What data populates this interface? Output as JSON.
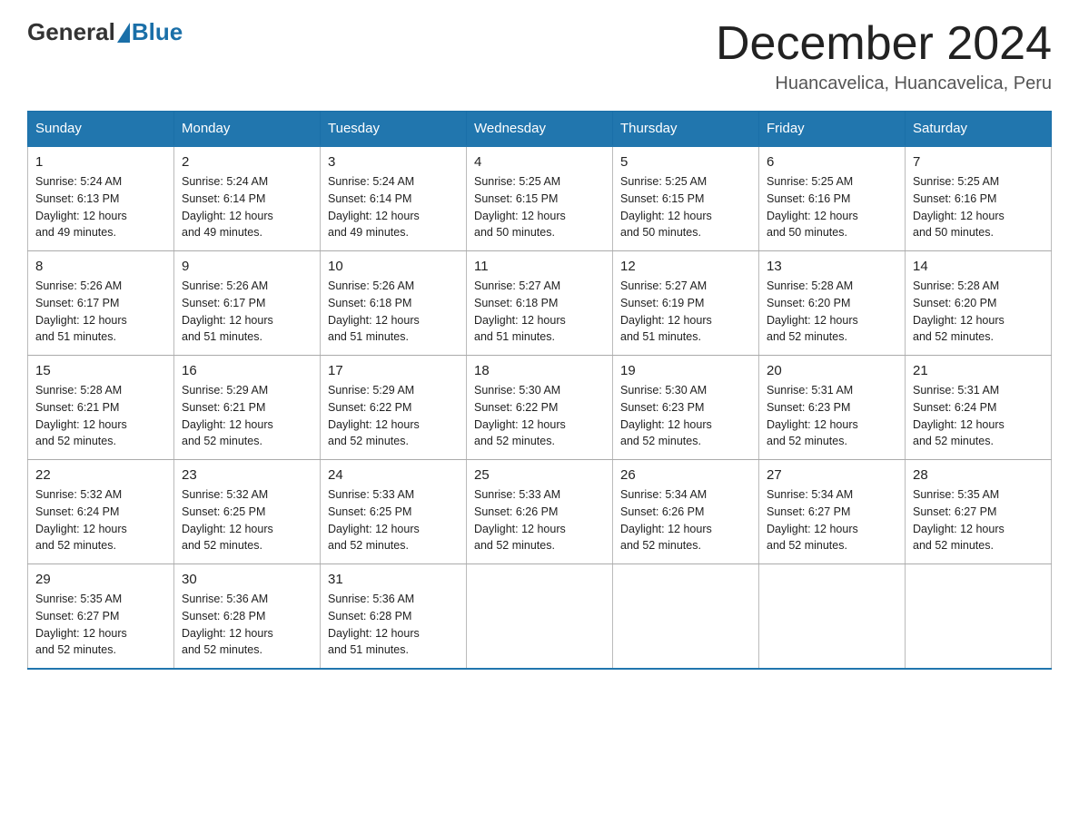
{
  "header": {
    "logo_general": "General",
    "logo_blue": "Blue",
    "month_title": "December 2024",
    "location": "Huancavelica, Huancavelica, Peru"
  },
  "days_of_week": [
    "Sunday",
    "Monday",
    "Tuesday",
    "Wednesday",
    "Thursday",
    "Friday",
    "Saturday"
  ],
  "weeks": [
    [
      {
        "day": "1",
        "sunrise": "5:24 AM",
        "sunset": "6:13 PM",
        "daylight": "12 hours and 49 minutes."
      },
      {
        "day": "2",
        "sunrise": "5:24 AM",
        "sunset": "6:14 PM",
        "daylight": "12 hours and 49 minutes."
      },
      {
        "day": "3",
        "sunrise": "5:24 AM",
        "sunset": "6:14 PM",
        "daylight": "12 hours and 49 minutes."
      },
      {
        "day": "4",
        "sunrise": "5:25 AM",
        "sunset": "6:15 PM",
        "daylight": "12 hours and 50 minutes."
      },
      {
        "day": "5",
        "sunrise": "5:25 AM",
        "sunset": "6:15 PM",
        "daylight": "12 hours and 50 minutes."
      },
      {
        "day": "6",
        "sunrise": "5:25 AM",
        "sunset": "6:16 PM",
        "daylight": "12 hours and 50 minutes."
      },
      {
        "day": "7",
        "sunrise": "5:25 AM",
        "sunset": "6:16 PM",
        "daylight": "12 hours and 50 minutes."
      }
    ],
    [
      {
        "day": "8",
        "sunrise": "5:26 AM",
        "sunset": "6:17 PM",
        "daylight": "12 hours and 51 minutes."
      },
      {
        "day": "9",
        "sunrise": "5:26 AM",
        "sunset": "6:17 PM",
        "daylight": "12 hours and 51 minutes."
      },
      {
        "day": "10",
        "sunrise": "5:26 AM",
        "sunset": "6:18 PM",
        "daylight": "12 hours and 51 minutes."
      },
      {
        "day": "11",
        "sunrise": "5:27 AM",
        "sunset": "6:18 PM",
        "daylight": "12 hours and 51 minutes."
      },
      {
        "day": "12",
        "sunrise": "5:27 AM",
        "sunset": "6:19 PM",
        "daylight": "12 hours and 51 minutes."
      },
      {
        "day": "13",
        "sunrise": "5:28 AM",
        "sunset": "6:20 PM",
        "daylight": "12 hours and 52 minutes."
      },
      {
        "day": "14",
        "sunrise": "5:28 AM",
        "sunset": "6:20 PM",
        "daylight": "12 hours and 52 minutes."
      }
    ],
    [
      {
        "day": "15",
        "sunrise": "5:28 AM",
        "sunset": "6:21 PM",
        "daylight": "12 hours and 52 minutes."
      },
      {
        "day": "16",
        "sunrise": "5:29 AM",
        "sunset": "6:21 PM",
        "daylight": "12 hours and 52 minutes."
      },
      {
        "day": "17",
        "sunrise": "5:29 AM",
        "sunset": "6:22 PM",
        "daylight": "12 hours and 52 minutes."
      },
      {
        "day": "18",
        "sunrise": "5:30 AM",
        "sunset": "6:22 PM",
        "daylight": "12 hours and 52 minutes."
      },
      {
        "day": "19",
        "sunrise": "5:30 AM",
        "sunset": "6:23 PM",
        "daylight": "12 hours and 52 minutes."
      },
      {
        "day": "20",
        "sunrise": "5:31 AM",
        "sunset": "6:23 PM",
        "daylight": "12 hours and 52 minutes."
      },
      {
        "day": "21",
        "sunrise": "5:31 AM",
        "sunset": "6:24 PM",
        "daylight": "12 hours and 52 minutes."
      }
    ],
    [
      {
        "day": "22",
        "sunrise": "5:32 AM",
        "sunset": "6:24 PM",
        "daylight": "12 hours and 52 minutes."
      },
      {
        "day": "23",
        "sunrise": "5:32 AM",
        "sunset": "6:25 PM",
        "daylight": "12 hours and 52 minutes."
      },
      {
        "day": "24",
        "sunrise": "5:33 AM",
        "sunset": "6:25 PM",
        "daylight": "12 hours and 52 minutes."
      },
      {
        "day": "25",
        "sunrise": "5:33 AM",
        "sunset": "6:26 PM",
        "daylight": "12 hours and 52 minutes."
      },
      {
        "day": "26",
        "sunrise": "5:34 AM",
        "sunset": "6:26 PM",
        "daylight": "12 hours and 52 minutes."
      },
      {
        "day": "27",
        "sunrise": "5:34 AM",
        "sunset": "6:27 PM",
        "daylight": "12 hours and 52 minutes."
      },
      {
        "day": "28",
        "sunrise": "5:35 AM",
        "sunset": "6:27 PM",
        "daylight": "12 hours and 52 minutes."
      }
    ],
    [
      {
        "day": "29",
        "sunrise": "5:35 AM",
        "sunset": "6:27 PM",
        "daylight": "12 hours and 52 minutes."
      },
      {
        "day": "30",
        "sunrise": "5:36 AM",
        "sunset": "6:28 PM",
        "daylight": "12 hours and 52 minutes."
      },
      {
        "day": "31",
        "sunrise": "5:36 AM",
        "sunset": "6:28 PM",
        "daylight": "12 hours and 51 minutes."
      },
      null,
      null,
      null,
      null
    ]
  ],
  "labels": {
    "sunrise": "Sunrise:",
    "sunset": "Sunset:",
    "daylight": "Daylight:"
  }
}
